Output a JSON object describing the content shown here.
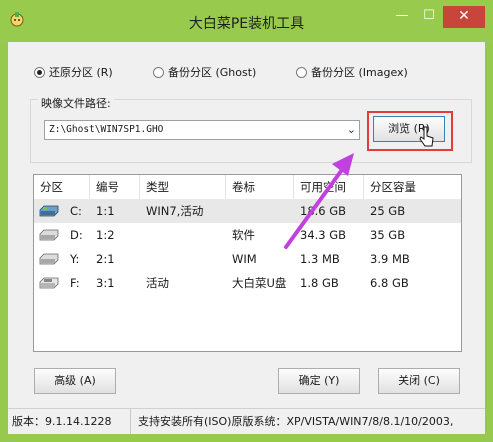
{
  "window": {
    "title": "大白菜PE装机工具",
    "min_glyph": "—",
    "max_glyph": "☐",
    "close_glyph": "✕"
  },
  "mode_options": [
    {
      "label": "还原分区 (R)",
      "checked": true
    },
    {
      "label": "备份分区 (Ghost)",
      "checked": false
    },
    {
      "label": "备份分区 (Imagex)",
      "checked": false
    }
  ],
  "image_path": {
    "group_label": "映像文件路径:",
    "value": "Z:\\Ghost\\WIN7SP1.GHO",
    "dropdown_glyph": "⌄",
    "browse_label": "浏览 (R)"
  },
  "partition_table": {
    "columns": [
      "分区",
      "编号",
      "类型",
      "卷标",
      "可用空间",
      "分区容量"
    ],
    "rows": [
      {
        "drive": "C:",
        "number": "1:1",
        "type": "WIN7,活动",
        "label": "",
        "free": "18.6 GB",
        "capacity": "25 GB",
        "selected": true
      },
      {
        "drive": "D:",
        "number": "1:2",
        "type": "",
        "label": "软件",
        "free": "34.3 GB",
        "capacity": "35 GB",
        "selected": false
      },
      {
        "drive": "Y:",
        "number": "2:1",
        "type": "",
        "label": "WIM",
        "free": "1.3 MB",
        "capacity": "3.9 MB",
        "selected": false
      },
      {
        "drive": "F:",
        "number": "3:1",
        "type": "活动",
        "label": "大白菜U盘",
        "free": "1.8 GB",
        "capacity": "6.8 GB",
        "selected": false
      }
    ]
  },
  "buttons": {
    "advanced": "高级 (A)",
    "ok": "确定 (Y)",
    "close": "关闭 (C)"
  },
  "status": {
    "version": "版本：9.1.14.1228",
    "support": "支持安装所有(ISO)原版系统：XP/VISTA/WIN7/8/8.1/10/2003,"
  },
  "colors": {
    "titlebar": "#98ca4e",
    "close_button": "#c7453a",
    "highlight_box": "#e23c3c",
    "pointer_arrow": "#c23fe0"
  },
  "icons": [
    "app-icon",
    "cursor-icon",
    "drive-icon",
    "pointer-arrow"
  ]
}
